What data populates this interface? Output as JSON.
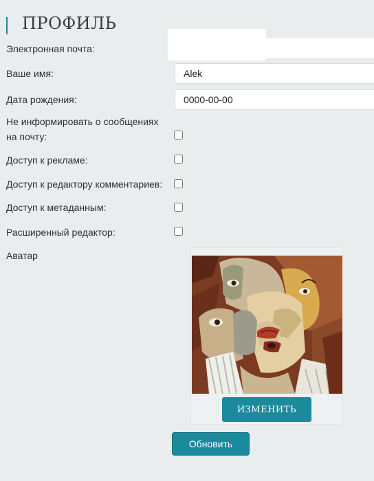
{
  "page": {
    "title": "ПРОФИЛЬ"
  },
  "form": {
    "email": {
      "label": "Электронная почта:",
      "value": ""
    },
    "name": {
      "label": "Ваше имя:",
      "value": "Alek"
    },
    "birthdate": {
      "label": "Дата рождения:",
      "value": "0000-00-00"
    },
    "options": [
      {
        "label": "Не информировать о сообщениях на почту:",
        "checked": false
      },
      {
        "label": "Доступ к рекламе:",
        "checked": false
      },
      {
        "label": "Доступ к редактору комментариев:",
        "checked": false
      },
      {
        "label": "Доступ к метаданным:",
        "checked": false
      },
      {
        "label": "Расширенный редактор:",
        "checked": false
      }
    ],
    "avatar": {
      "label": "Аватар",
      "change_label": "ИЗМЕНИТЬ"
    },
    "submit_label": "Обновить"
  },
  "colors": {
    "accent": "#1b8a9d",
    "page_background": "#e9edee"
  }
}
